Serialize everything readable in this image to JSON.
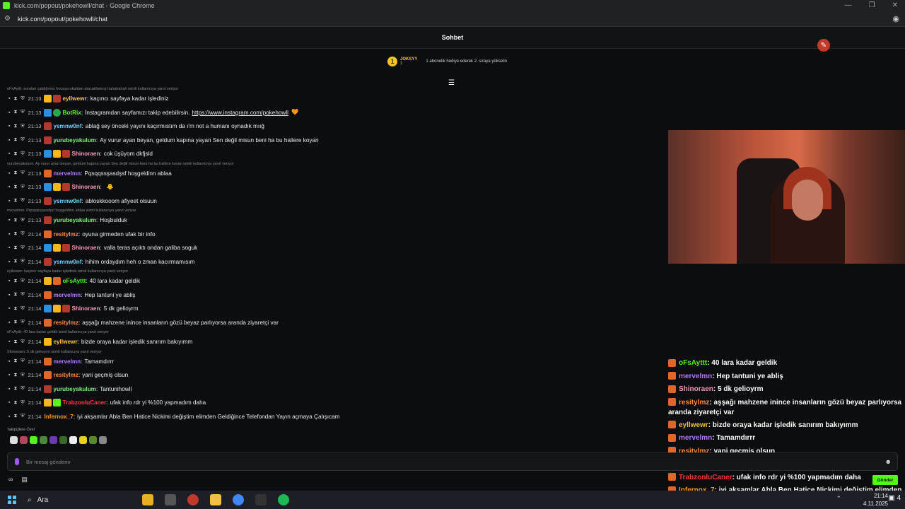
{
  "window": {
    "title": "kick.com/popout/pokehowll/chat - Google Chrome",
    "url": "kick.com/popout/pokehowll/chat"
  },
  "chat": {
    "header": "Sohbet",
    "pinned": {
      "rank": "1",
      "user": "JOKSYY",
      "subs": "1",
      "message": "1 abonelik hediye ederek 2. sıraya yükselin"
    },
    "messages": [
      {
        "reply": "oFsAyttt: sorulan çaldığımız hocaya okuldan atacaklarmış hahahahah isimli kullanıcıya yanıt veriyor"
      },
      {
        "time": "21:13",
        "badges": [
          "crown",
          "fox"
        ],
        "name": "eyllwewr",
        "color": "#f5c542",
        "text": "kaçıncı sayfaya kadar işlediniz"
      },
      {
        "time": "21:13",
        "badges": [
          "blue",
          "green"
        ],
        "name": "BotRix",
        "color": "#53fc18",
        "text": "İnstagramdan sayfamızı takip edebilirsin.",
        "link": "https://www.instagram.com/pokehowll",
        "emoji": "🧡"
      },
      {
        "time": "21:13",
        "badges": [
          "fox"
        ],
        "name": "ysmnw0nf",
        "color": "#6fd3ff",
        "text": "ablağ sey önceki yayını kaçırmıstım da ı'm not a humanı oynadık mıığ"
      },
      {
        "time": "21:13",
        "badges": [
          "fox"
        ],
        "name": "yurubeyakulum",
        "color": "#7df07d",
        "text": "Ay vurur ayan beyan, geldum kapına yayan Sen değil misun beni ha bu hallere koyan"
      },
      {
        "time": "21:13",
        "badges": [
          "blue",
          "crown",
          "fox"
        ],
        "name": "Shinoraen",
        "color": "#f59cb8",
        "text": "cok üşüyom dkfjsld"
      },
      {
        "reply": "yurubeyakulum: Ay vurur ayan beyan, geldum kapına yayan Sen değil misun beni ha bu hallere koyan isimli kullanıcıya yanıt veriyor"
      },
      {
        "time": "21:13",
        "badges": [
          "orange"
        ],
        "name": "mervelmn",
        "color": "#b57cff",
        "text": "Pqsqqssşasdşsf hoşgeldinn ablaa"
      },
      {
        "time": "21:13",
        "badges": [
          "blue",
          "crown",
          "fox"
        ],
        "name": "Shinoraen",
        "color": "#f59cb8",
        "text": "",
        "emoji": "🐥"
      },
      {
        "time": "21:13",
        "badges": [
          "fox"
        ],
        "name": "ysmnw0nf",
        "color": "#6fd3ff",
        "text": "abloskkooom afiyeet olsuun"
      },
      {
        "reply": "mervelmn: Pqsqqssşasdşsf hoşgeldinn ablaa isimli kullanıcıya yanıt veriyor"
      },
      {
        "time": "21:13",
        "badges": [
          "fox"
        ],
        "name": "yurubeyakulum",
        "color": "#7df07d",
        "text": "Hoşbulduk"
      },
      {
        "time": "21:14",
        "badges": [
          "orange"
        ],
        "name": "resitylmz",
        "color": "#ff8c42",
        "text": "oyuna girmeden ufak bir info"
      },
      {
        "time": "21:14",
        "badges": [
          "blue",
          "crown",
          "fox"
        ],
        "name": "Shinoraen",
        "color": "#f59cb8",
        "text": "valla teras açıktı ondan galiba soguk"
      },
      {
        "time": "21:14",
        "badges": [
          "fox"
        ],
        "name": "ysmnw0nf",
        "color": "#6fd3ff",
        "text": "hihim ordaydım heh o zman kacırmamısım"
      },
      {
        "reply": "eyllwewr: kaçıncı sayfaya kadar işlediniz isimli kullanıcıya yanıt veriyor"
      },
      {
        "time": "21:14",
        "badges": [
          "crown",
          "orange"
        ],
        "name": "oFsAyttt",
        "color": "#53fc18",
        "text": "40 lara kadar geldik"
      },
      {
        "time": "21:14",
        "badges": [
          "orange"
        ],
        "name": "mervelmn",
        "color": "#b57cff",
        "text": "Hep tantuni ye abliş"
      },
      {
        "time": "21:14",
        "badges": [
          "blue",
          "crown",
          "fox"
        ],
        "name": "Shinoraen",
        "color": "#f59cb8",
        "text": "5 dk gelioyrm"
      },
      {
        "time": "21:14",
        "badges": [
          "orange"
        ],
        "name": "resitylmz",
        "color": "#ff8c42",
        "text": "aşşağı mahzene inince insanların gözü beyaz parlıyorsa aranda ziyaretçi var"
      },
      {
        "reply": "oFsAyttt: 40 lara kadar geldik isimli kullanıcıya yanıt veriyor"
      },
      {
        "time": "21:14",
        "badges": [
          "crown"
        ],
        "name": "eyllwewr",
        "color": "#f5c542",
        "text": "bizde oraya kadar işledik sanırım bakıyımm"
      },
      {
        "reply": "Shinoraen: 5 dk gelioyrm isimli kullanıcıya yanıt veriyor"
      },
      {
        "time": "21:14",
        "badges": [
          "orange"
        ],
        "name": "mervelmn",
        "color": "#b57cff",
        "text": "Tamamdırrr"
      },
      {
        "time": "21:14",
        "badges": [
          "orange"
        ],
        "name": "resitylmz",
        "color": "#ff8c42",
        "text": "yani geçmiş olsun"
      },
      {
        "time": "21:14",
        "badges": [
          "fox"
        ],
        "name": "yurubeyakulum",
        "color": "#7df07d",
        "text": "Tantunihowll"
      },
      {
        "time": "21:14",
        "badges": [
          "crown",
          "sub"
        ],
        "name": "TrabzonluCaner",
        "color": "#ff3b3b",
        "text": "ufak info rdr yi %100 yapmadım daha"
      },
      {
        "time": "21:14",
        "badges": [],
        "name": "Infernox_7",
        "color": "#ff9f1c",
        "text": "iyi akşamlar Abla Ben Hatice Nickimi değiştim elimden Geldiğince Telefondan Yayın açmaya Çalışıcam"
      }
    ],
    "followers_label": "Takipçilere Özel",
    "input_placeholder": "Bir mesaj gönderin",
    "send_label": "Gönder",
    "loop_label": "∞"
  },
  "overlay": [
    {
      "name": "oFsAyttt",
      "color": "#53fc18",
      "text": ": 40 lara kadar geldik"
    },
    {
      "name": "mervelmn",
      "color": "#b57cff",
      "text": ": Hep tantuni ye abliş"
    },
    {
      "name": "Shinoraen",
      "color": "#f59cb8",
      "text": ": 5 dk gelioyrm"
    },
    {
      "name": "resitylmz",
      "color": "#ff8c42",
      "text": ": aşşağı mahzene inince insanların gözü beyaz parlıyorsa aranda ziyaretçi var",
      "wrap": true
    },
    {
      "name": "eyllwewr",
      "color": "#f5c542",
      "text": ": bizde oraya kadar işledik sanırım bakıyımm"
    },
    {
      "name": "mervelmn",
      "color": "#b57cff",
      "text": ": Tamamdırrr"
    },
    {
      "name": "resitylmz",
      "color": "#ff8c42",
      "text": ": yani geçmiş olsun"
    },
    {
      "name": "yurubeyakulum",
      "color": "#7df07d",
      "text": ": Tantunihowll"
    },
    {
      "name": "TrabzonluCaner",
      "color": "#ff3b3b",
      "text": ": ufak info rdr yi %100 yapmadım daha"
    },
    {
      "name": "Infernox_7",
      "color": "#ff9f1c",
      "text": ": iyi akşamlar Abla Ben Hatice Nickimi değiştim elimden Geldiğince Telefondan Yayın açmaya Çalışıcam",
      "wrap": true
    }
  ],
  "taskbar": {
    "search_label": "Ara",
    "time": "21:14",
    "date": "4.11.2025",
    "notif_count": "4"
  }
}
